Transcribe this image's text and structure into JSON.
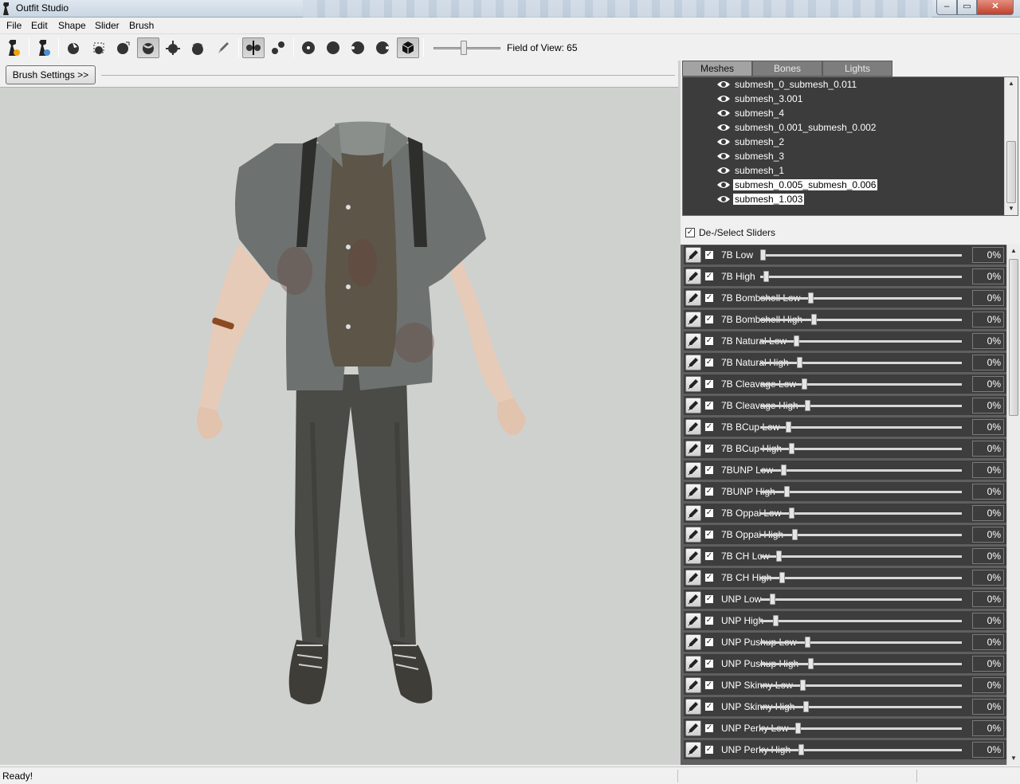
{
  "window": {
    "title": "Outfit Studio",
    "minimize": "‒",
    "maximize": "▭",
    "close": "✕"
  },
  "menu": [
    "File",
    "Edit",
    "Shape",
    "Slider",
    "Brush"
  ],
  "toolbar": {
    "fov_label": "Field of View: 65",
    "fov_value": 65,
    "tools": [
      {
        "name": "load-reference-icon",
        "active": false
      },
      {
        "name": "load-outfit-icon",
        "active": false
      },
      {
        "name": "select-brush-icon",
        "active": false
      },
      {
        "name": "mask-brush-icon",
        "active": false
      },
      {
        "name": "inflate-brush-icon",
        "active": false
      },
      {
        "name": "deflate-brush-icon",
        "active": true
      },
      {
        "name": "move-brush-icon",
        "active": false
      },
      {
        "name": "smooth-brush-icon",
        "active": false
      },
      {
        "name": "weight-brush-icon",
        "active": false
      },
      {
        "name": "xmirror-icon",
        "active": true
      },
      {
        "name": "connected-only-icon",
        "active": false
      },
      {
        "name": "front-view-icon",
        "active": false
      },
      {
        "name": "back-view-icon",
        "active": false
      },
      {
        "name": "left-view-icon",
        "active": false
      },
      {
        "name": "right-view-icon",
        "active": false
      },
      {
        "name": "perspective-view-icon",
        "active": true
      }
    ]
  },
  "brush_settings_label": "Brush Settings >>",
  "tabs": [
    {
      "label": "Meshes",
      "active": true
    },
    {
      "label": "Bones",
      "active": false
    },
    {
      "label": "Lights",
      "active": false
    }
  ],
  "meshes": [
    {
      "name": "submesh_0_submesh_0.011",
      "selected": false
    },
    {
      "name": "submesh_3.001",
      "selected": false
    },
    {
      "name": "submesh_4",
      "selected": false
    },
    {
      "name": "submesh_0.001_submesh_0.002",
      "selected": false
    },
    {
      "name": "submesh_2",
      "selected": false
    },
    {
      "name": "submesh_3",
      "selected": false
    },
    {
      "name": "submesh_1",
      "selected": false
    },
    {
      "name": "submesh_0.005_submesh_0.006",
      "selected": true
    },
    {
      "name": "submesh_1.003",
      "selected": true
    }
  ],
  "deselect_label": "De-/Select Sliders",
  "sliders": [
    {
      "label": "7B Low",
      "value": "0%",
      "pos": 0.0
    },
    {
      "label": "7B High",
      "value": "0%",
      "pos": 0.016
    },
    {
      "label": "7B Bombshell Low",
      "value": "0%",
      "pos": 0.237
    },
    {
      "label": "7B Bombshell High",
      "value": "0%",
      "pos": 0.253
    },
    {
      "label": "7B Natural Low",
      "value": "0%",
      "pos": 0.166
    },
    {
      "label": "7B Natural High",
      "value": "0%",
      "pos": 0.182
    },
    {
      "label": "7B Cleavage Low",
      "value": "0%",
      "pos": 0.206
    },
    {
      "label": "7B Cleavage High",
      "value": "0%",
      "pos": 0.221
    },
    {
      "label": "7B BCup Low",
      "value": "0%",
      "pos": 0.126
    },
    {
      "label": "7B BCup High",
      "value": "0%",
      "pos": 0.142
    },
    {
      "label": "7BUNP Low",
      "value": "0%",
      "pos": 0.103
    },
    {
      "label": "7BUNP High",
      "value": "0%",
      "pos": 0.119
    },
    {
      "label": "7B Oppai Low",
      "value": "0%",
      "pos": 0.142
    },
    {
      "label": "7B Oppai High",
      "value": "0%",
      "pos": 0.158
    },
    {
      "label": "7B CH Low",
      "value": "0%",
      "pos": 0.079
    },
    {
      "label": "7B CH High",
      "value": "0%",
      "pos": 0.095
    },
    {
      "label": "UNP Low",
      "value": "0%",
      "pos": 0.047
    },
    {
      "label": "UNP High",
      "value": "0%",
      "pos": 0.063
    },
    {
      "label": "UNP Pushup Low",
      "value": "0%",
      "pos": 0.221
    },
    {
      "label": "UNP Pushup High",
      "value": "0%",
      "pos": 0.237
    },
    {
      "label": "UNP Skinny Low",
      "value": "0%",
      "pos": 0.198
    },
    {
      "label": "UNP Skinny High",
      "value": "0%",
      "pos": 0.214
    },
    {
      "label": "UNP Perky Low",
      "value": "0%",
      "pos": 0.174
    },
    {
      "label": "UNP Perky High",
      "value": "0%",
      "pos": 0.19
    }
  ],
  "status": "Ready!",
  "colors": {
    "slider_bg": "#3d3d3d",
    "viewport_bg": "#cfd1cf",
    "mesh_list_bg": "#3c3c3c"
  }
}
